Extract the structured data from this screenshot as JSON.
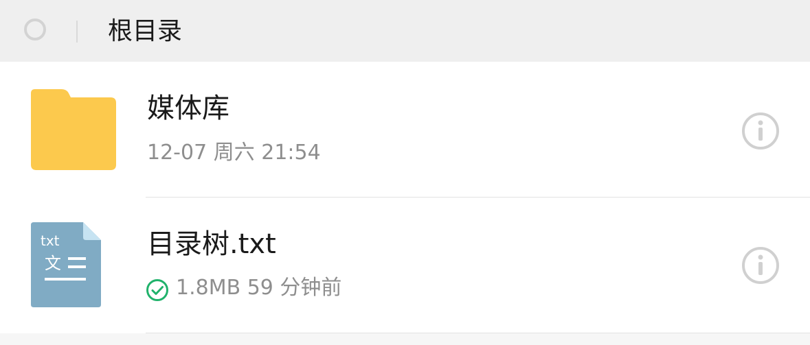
{
  "header": {
    "title": "根目录"
  },
  "files": [
    {
      "name": "媒体库",
      "meta": "12-07 周六 21:54",
      "icon": "folder-icon"
    },
    {
      "name": "目录树.txt",
      "meta": "1.8MB 59 分钟前",
      "icon": "txt-file-icon",
      "icon_label": "txt",
      "icon_glyph": "文",
      "sync_status_icon": "synced-check-icon"
    }
  ],
  "colors": {
    "header_bg": "#efefef",
    "folder": "#fcc94d",
    "txt_file": "#80abc4",
    "synced": "#20b26b",
    "info_icon": "#d0d0d0",
    "meta_text": "#8e8e8e"
  }
}
